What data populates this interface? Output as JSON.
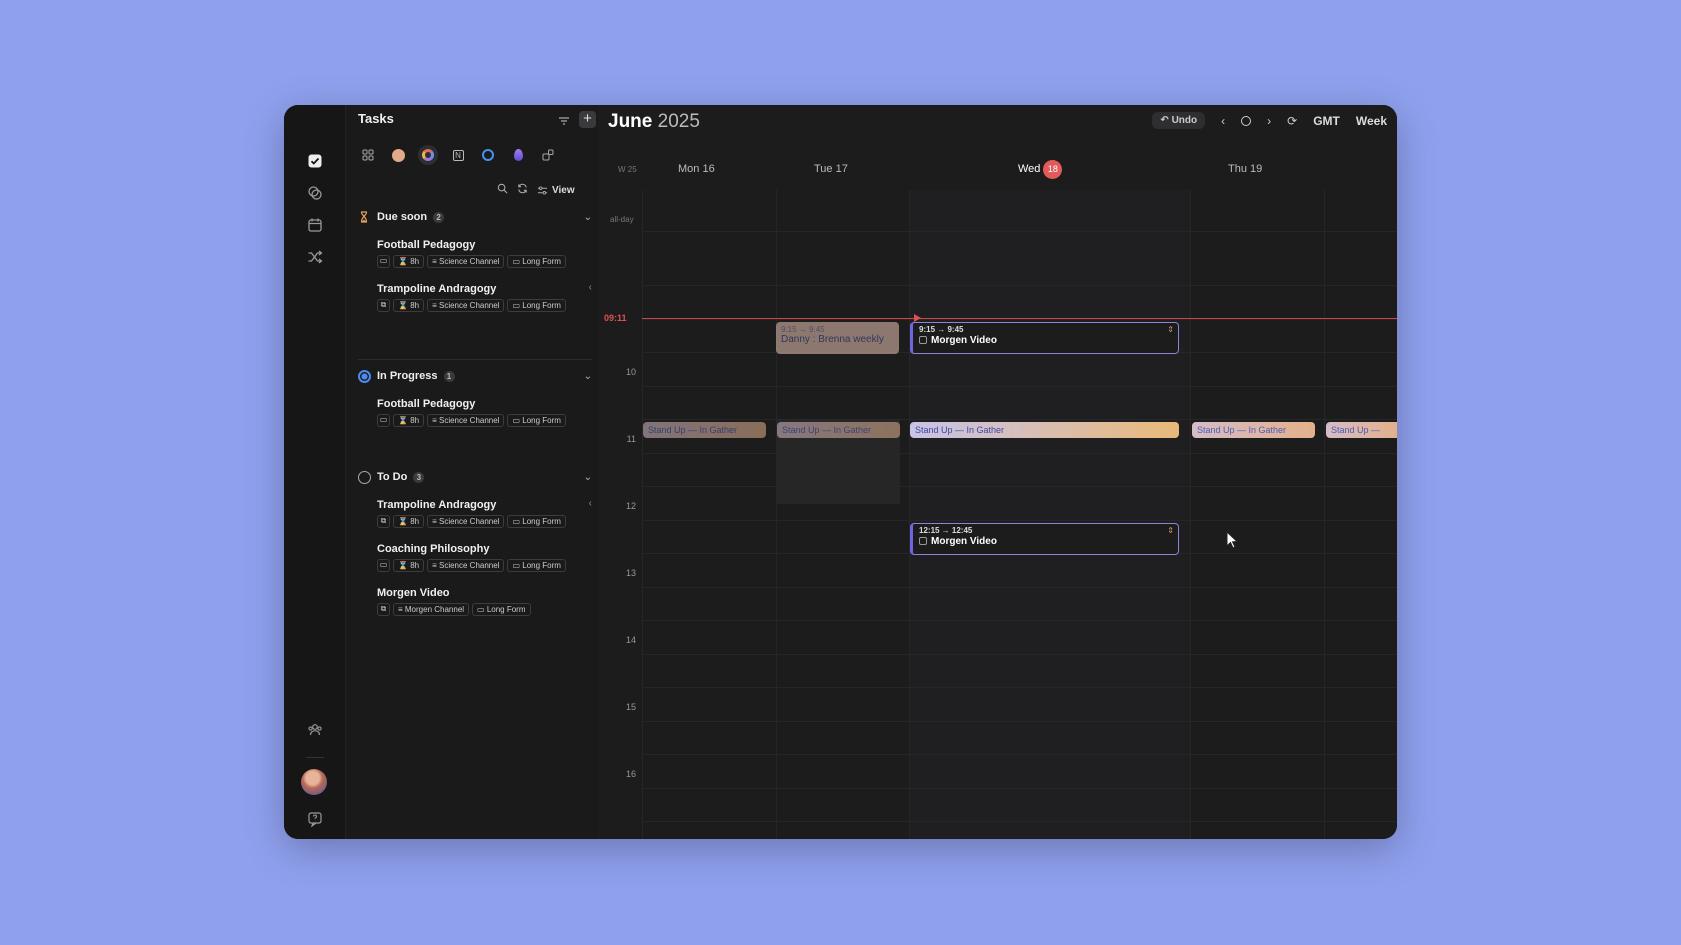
{
  "sidebar": {
    "icons": [
      "check-square-icon",
      "link-icon",
      "calendar-icon",
      "shuffle-icon"
    ],
    "bottom_icons": [
      "team-icon",
      "avatar",
      "help-icon"
    ]
  },
  "tasks": {
    "title": "Tasks",
    "view_label": "View",
    "sources": [
      "grid-icon",
      "peach-dot",
      "rainbow-icon",
      "notion-icon",
      "todo-icon",
      "droplet-icon",
      "addon-icon"
    ],
    "groups": [
      {
        "name": "Due soon",
        "count": "2",
        "items": [
          {
            "title": "Football Pedagogy",
            "duration": "8h",
            "channel": "Science Channel",
            "format": "Long Form"
          },
          {
            "title": "Trampoline Andragogy",
            "duration": "8h",
            "channel": "Science Channel",
            "format": "Long Form"
          }
        ]
      },
      {
        "name": "In Progress",
        "count": "1",
        "items": [
          {
            "title": "Football Pedagogy",
            "duration": "8h",
            "channel": "Science Channel",
            "format": "Long Form"
          }
        ]
      },
      {
        "name": "To Do",
        "count": "3",
        "items": [
          {
            "title": "Trampoline Andragogy",
            "duration": "8h",
            "channel": "Science Channel",
            "format": "Long Form"
          },
          {
            "title": "Coaching Philosophy",
            "duration": "8h",
            "channel": "Science Channel",
            "format": "Long Form"
          },
          {
            "title": "Morgen Video",
            "channel": "Morgen Channel",
            "format": "Long Form"
          }
        ]
      }
    ]
  },
  "calendar": {
    "month": "June",
    "year": "2025",
    "undo": "Undo",
    "timezone": "GMT",
    "view": "Week",
    "week": "W 25",
    "allday": "all-day",
    "days": [
      {
        "label": "Mon 16"
      },
      {
        "label": "Tue 17"
      },
      {
        "label": "Wed",
        "badge": "18"
      },
      {
        "label": "Thu 19"
      }
    ],
    "hours": [
      "10",
      "11",
      "12",
      "13",
      "14",
      "15",
      "16"
    ],
    "now": "09:11",
    "events": {
      "danny": {
        "time": "9:15 → 9:45",
        "name": "Danny : Brenna weekly"
      },
      "morgen1": {
        "time": "9:15 → 9:45",
        "name": "Morgen Video"
      },
      "morgen2": {
        "time": "12:15 → 12:45",
        "name": "Morgen Video"
      },
      "standup": "Stand Up — In Gather",
      "standup_cut": "Stand Up —"
    }
  }
}
